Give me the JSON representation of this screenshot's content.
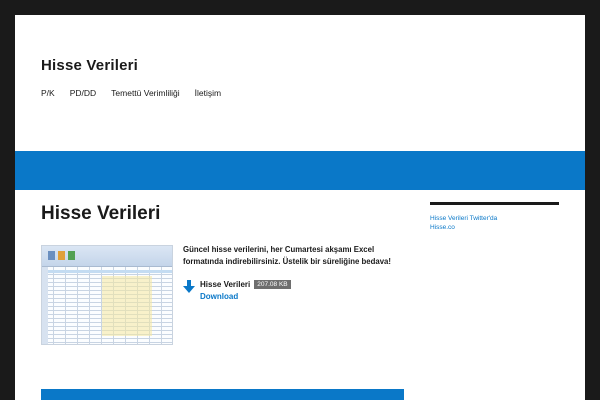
{
  "site": {
    "title": "Hisse Verileri"
  },
  "nav": {
    "items": [
      "P/K",
      "PD/DD",
      "Temettü Verimliliği",
      "İletişim"
    ]
  },
  "page": {
    "title": "Hisse Verileri"
  },
  "sidebar": {
    "links": [
      "Hisse Verileri Twitter'da",
      "Hisse.co"
    ]
  },
  "content": {
    "description": "Güncel hisse verilerini, her Cumartesi akşamı Excel formatında indirebilirsiniz. Üstelik bir süreliğine bedava!",
    "download": {
      "file_name": "Hisse Verileri",
      "file_size": "207.08 KB",
      "download_label": "Download"
    }
  },
  "colors": {
    "accent": "#0a78c8",
    "frame": "#1a1a1a",
    "badge": "#6e6e6e"
  },
  "icons": {
    "download": "download-arrow-icon"
  }
}
